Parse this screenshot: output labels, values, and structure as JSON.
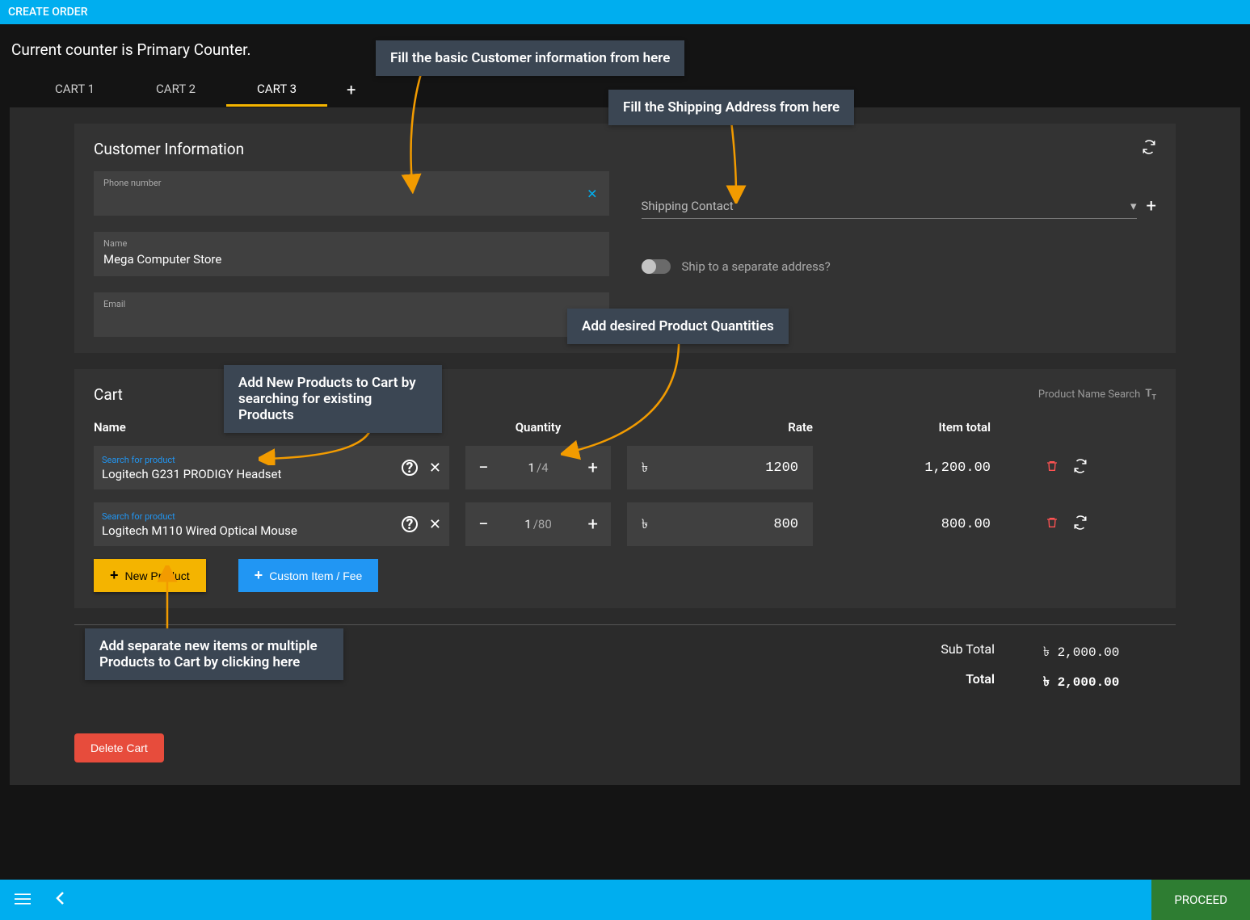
{
  "header": {
    "title": "CREATE ORDER"
  },
  "counter_line": "Current counter is Primary Counter.",
  "tabs": {
    "items": [
      {
        "label": "CART 1"
      },
      {
        "label": "CART 2"
      },
      {
        "label": "CART 3"
      }
    ],
    "active_index": 2
  },
  "customer": {
    "section_title": "Customer Information",
    "phone_label": "Phone number",
    "phone_value": "",
    "name_label": "Name",
    "name_value": "Mega Computer Store",
    "email_label": "Email",
    "email_value": "",
    "shipping_contact_label": "Shipping Contact",
    "ship_separate_label": "Ship to a separate address?"
  },
  "cart": {
    "section_title": "Cart",
    "product_name_search": "Product Name Search",
    "columns": {
      "name": "Name",
      "quantity": "Quantity",
      "rate": "Rate",
      "item_total": "Item total"
    },
    "search_label": "Search for product",
    "currency_symbol": "৳",
    "rows": [
      {
        "product": "Logitech G231 PRODIGY Headset",
        "qty": "1",
        "stock": "/4",
        "rate": "1200",
        "total": "1,200.00"
      },
      {
        "product": "Logitech M110 Wired Optical Mouse",
        "qty": "1",
        "stock": "/80",
        "rate": "800",
        "total": "800.00"
      }
    ],
    "new_product_btn": "New Product",
    "custom_item_btn": "Custom Item / Fee"
  },
  "totals": {
    "subtotal_label": "Sub Total",
    "subtotal_value": "৳ 2,000.00",
    "total_label": "Total",
    "total_value": "৳ 2,000.00"
  },
  "delete_cart_btn": "Delete Cart",
  "proceed_btn": "PROCEED",
  "annotations": {
    "a1": "Fill the basic Customer information from here",
    "a2": "Fill the Shipping Address from here",
    "a3": "Add desired Product Quantities",
    "a4": "Add New Products to Cart by searching for existing Products",
    "a5": "Add separate new items or multiple Products to Cart by clicking here"
  }
}
